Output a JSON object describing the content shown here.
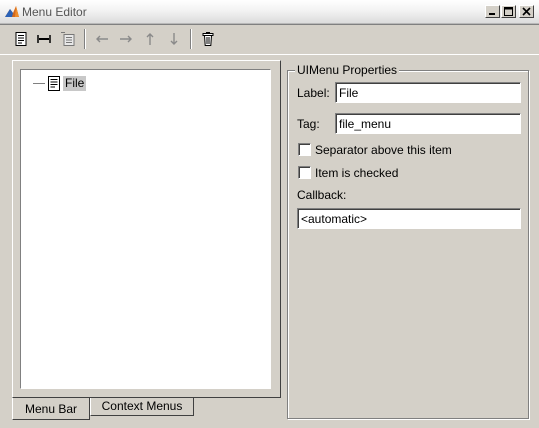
{
  "window": {
    "title": "Menu Editor",
    "controls": {
      "minimize": "minimize",
      "maximize": "maximize",
      "close": "close"
    }
  },
  "toolbar": {
    "icons": [
      "new-menu-icon",
      "new-menu-item-icon",
      "new-context-menu-icon",
      "move-left-icon",
      "move-right-icon",
      "move-up-icon",
      "move-down-icon",
      "delete-icon"
    ]
  },
  "tree": {
    "items": [
      {
        "label": "File",
        "selected": true
      }
    ]
  },
  "tabs": [
    {
      "label": "Menu Bar",
      "active": true
    },
    {
      "label": "Context Menus",
      "active": false
    }
  ],
  "properties": {
    "group_title": "UIMenu Properties",
    "label_caption": "Label:",
    "label_value": "File",
    "tag_caption": "Tag:",
    "tag_value": "file_menu",
    "separator_label": "Separator above this item",
    "separator_checked": false,
    "checked_label": "Item is checked",
    "checked_checked": false,
    "callback_caption": "Callback:",
    "callback_value": "<automatic>"
  }
}
